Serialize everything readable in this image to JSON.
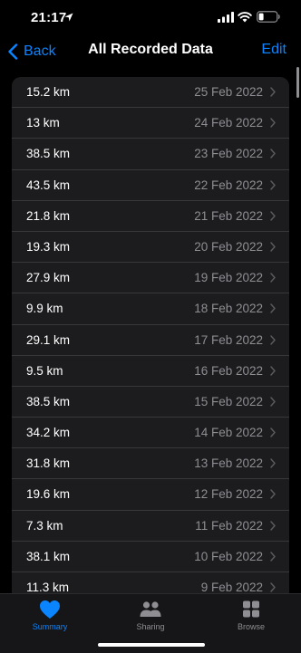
{
  "status_bar": {
    "time": "21:17",
    "icons": [
      "location-arrow-icon",
      "cellular-signal-icon",
      "wifi-icon",
      "battery-icon"
    ]
  },
  "nav": {
    "back_label": "Back",
    "title": "All Recorded Data",
    "edit_label": "Edit"
  },
  "records": [
    {
      "distance": "15.2 km",
      "date": "25 Feb 2022"
    },
    {
      "distance": "13 km",
      "date": "24 Feb 2022"
    },
    {
      "distance": "38.5 km",
      "date": "23 Feb 2022"
    },
    {
      "distance": "43.5 km",
      "date": "22 Feb 2022"
    },
    {
      "distance": "21.8 km",
      "date": "21 Feb 2022"
    },
    {
      "distance": "19.3 km",
      "date": "20 Feb 2022"
    },
    {
      "distance": "27.9 km",
      "date": "19 Feb 2022"
    },
    {
      "distance": "9.9 km",
      "date": "18 Feb 2022"
    },
    {
      "distance": "29.1 km",
      "date": "17 Feb 2022"
    },
    {
      "distance": "9.5 km",
      "date": "16 Feb 2022"
    },
    {
      "distance": "38.5 km",
      "date": "15 Feb 2022"
    },
    {
      "distance": "34.2 km",
      "date": "14 Feb 2022"
    },
    {
      "distance": "31.8 km",
      "date": "13 Feb 2022"
    },
    {
      "distance": "19.6 km",
      "date": "12 Feb 2022"
    },
    {
      "distance": "7.3 km",
      "date": "11 Feb 2022"
    },
    {
      "distance": "38.1 km",
      "date": "10 Feb 2022"
    },
    {
      "distance": "11.3 km",
      "date": "9 Feb 2022"
    }
  ],
  "tab_bar": {
    "summary": "Summary",
    "sharing": "Sharing",
    "browse": "Browse"
  },
  "colors": {
    "accent": "#0a84ff",
    "background": "#000000",
    "card": "#1c1c1e",
    "secondary_text": "#8e8e93"
  }
}
